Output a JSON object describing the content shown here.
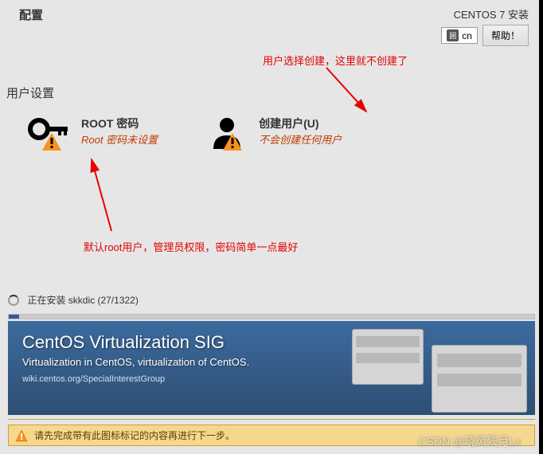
{
  "header": {
    "title": "配置",
    "install_label": "CENTOS 7 安装",
    "keyboard": "cn",
    "help": "帮助！"
  },
  "annotations": {
    "top": "用户选择创建，这里就不创建了",
    "bottom": "默认root用户，管理员权限，密码简单一点最好"
  },
  "section": {
    "title": "用户设置"
  },
  "root": {
    "title": "ROOT 密码",
    "subtitle": "Root 密码未设置"
  },
  "user": {
    "title": "创建用户(U)",
    "subtitle": "不会创建任何用户"
  },
  "progress": {
    "text": "正在安装 skkdic (27/1322)"
  },
  "banner": {
    "title": "CentOS Virtualization SIG",
    "subtitle": "Virtualization in CentOS, virtualization of CentOS.",
    "link": "wiki.centos.org/SpecialInterestGroup"
  },
  "warning": {
    "text": "请先完成带有此图标标记的内容再进行下一步。"
  },
  "watermark": "CSDN @晓风残月Lx"
}
